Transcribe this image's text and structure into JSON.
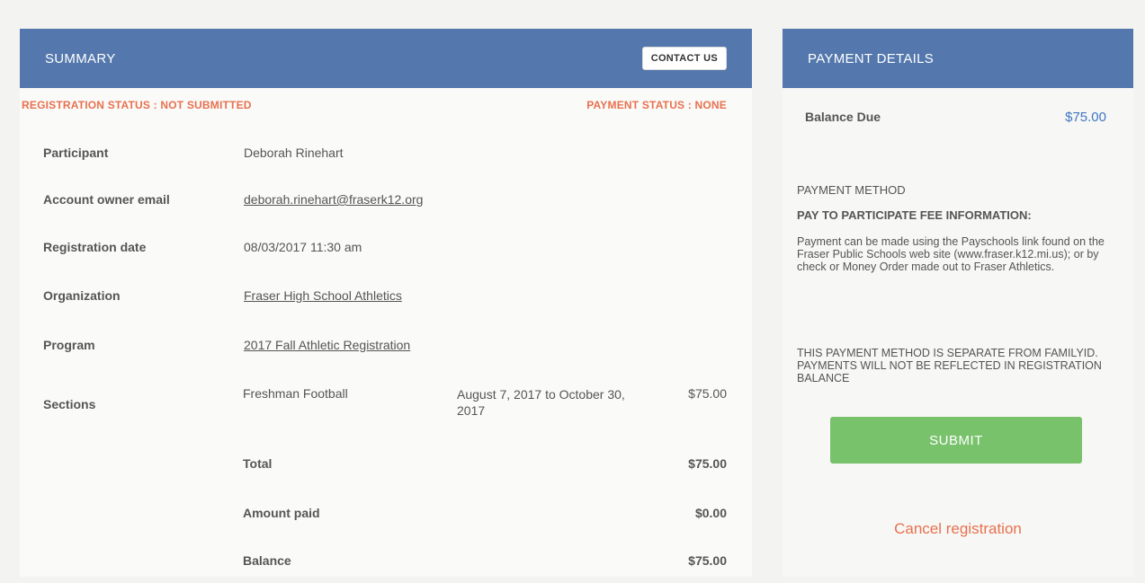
{
  "summary": {
    "title": "SUMMARY",
    "contact_label": "CONTACT US",
    "registration_status": "REGISTRATION STATUS : NOT SUBMITTED",
    "payment_status": "PAYMENT STATUS : NONE",
    "fields": {
      "participant_label": "Participant",
      "participant_value": "Deborah Rinehart",
      "email_label": "Account owner email",
      "email_value": "deborah.rinehart@fraserk12.org",
      "date_label": "Registration date",
      "date_value": "08/03/2017 11:30 am",
      "org_label": "Organization",
      "org_value": "Fraser High School Athletics",
      "program_label": "Program",
      "program_value": "2017 Fall Athletic Registration",
      "sections_label": "Sections"
    },
    "sections": [
      {
        "name": "Freshman Football",
        "dates": "August 7, 2017 to October 30, 2017",
        "amount": "$75.00"
      }
    ],
    "total_label": "Total",
    "total_value": "$75.00",
    "paid_label": "Amount paid",
    "paid_value": "$0.00",
    "balance_label": "Balance",
    "balance_value": "$75.00"
  },
  "payment": {
    "title": "PAYMENT DETAILS",
    "balance_due_label": "Balance Due",
    "balance_due_value": "$75.00",
    "method_title": "PAYMENT METHOD",
    "method_subtitle": "PAY TO PARTICIPATE FEE INFORMATION:",
    "method_info": "Payment can be made using the Payschools link found on the Fraser Public Schools web site (www.fraser.k12.mi.us); or by check or Money Order made out to Fraser Athletics.",
    "method_warning": "THIS PAYMENT METHOD IS SEPARATE FROM FAMILYID. PAYMENTS WILL NOT BE REFLECTED IN REGISTRATION BALANCE",
    "submit_label": "SUBMIT",
    "cancel_label": "Cancel registration"
  },
  "colors": {
    "header_blue": "#5478ad",
    "status_orange": "#e8714f",
    "link_blue": "#3f77c4",
    "submit_green": "#78c26c"
  }
}
